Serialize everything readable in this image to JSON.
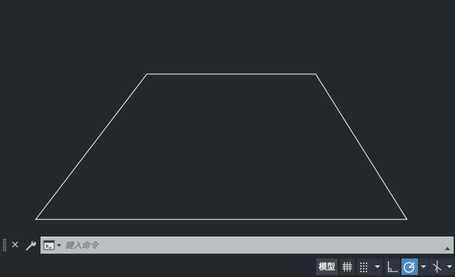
{
  "drawing": {
    "line_color": "#e6e8ea",
    "background": "#212830"
  },
  "command_line": {
    "placeholder": "鍵入命令",
    "close_icon": "close-icon",
    "customize_icon": "wrench-icon",
    "prompt_icon": "command-prompt-icon",
    "history_icon": "triangle-up-icon"
  },
  "status_bar": {
    "model_label": "模型",
    "active_color": "#4d86c6",
    "icons": [
      "grid-icon",
      "snap-icon",
      "chevron-down-icon",
      "ortho-icon",
      "polar-tracking-icon",
      "chevron-down-icon",
      "isodraft-icon",
      "chevron-down-icon"
    ]
  }
}
